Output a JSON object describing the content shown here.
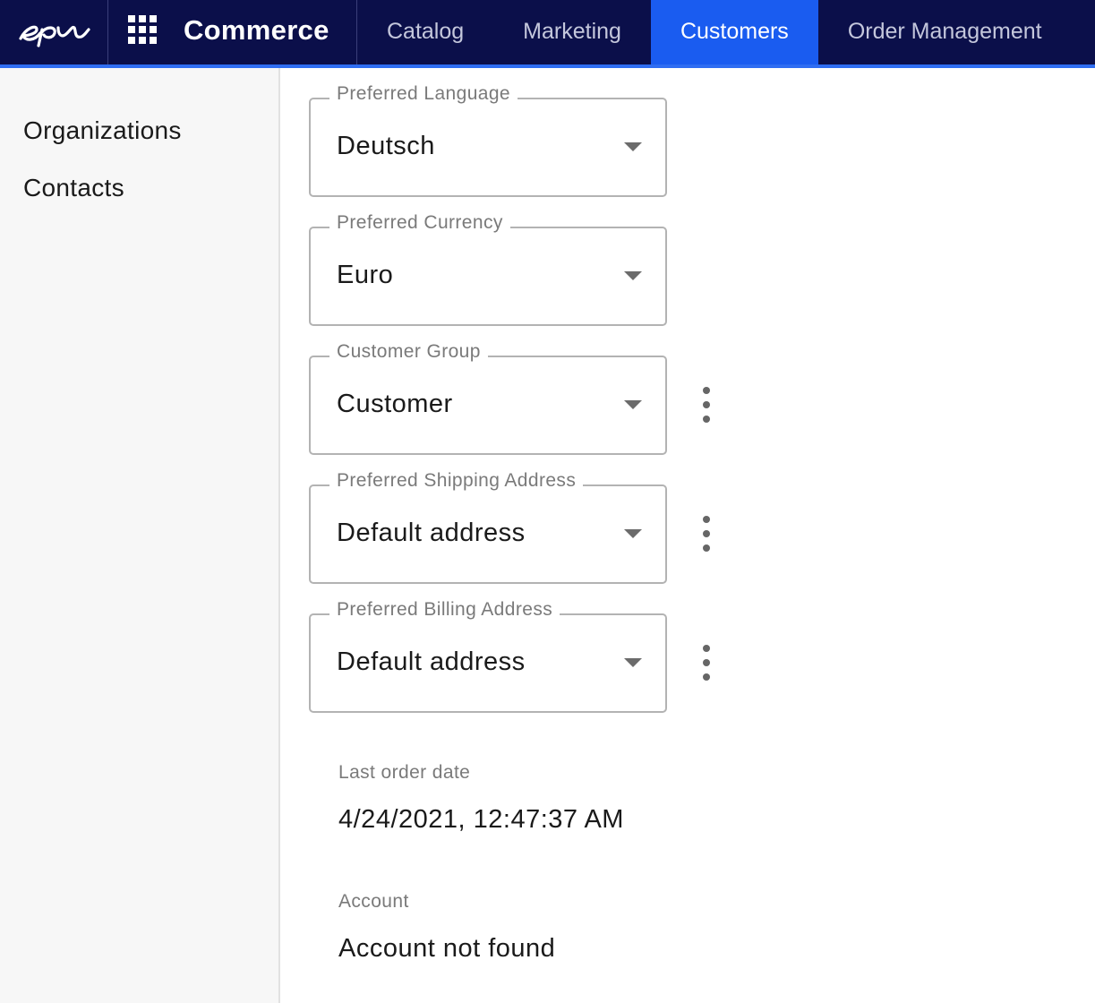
{
  "header": {
    "logo_text": "epi",
    "app_title": "Commerce",
    "nav": [
      {
        "label": "Catalog",
        "active": false
      },
      {
        "label": "Marketing",
        "active": false
      },
      {
        "label": "Customers",
        "active": true
      },
      {
        "label": "Order Management",
        "active": false
      }
    ]
  },
  "sidebar": {
    "items": [
      {
        "label": "Organizations"
      },
      {
        "label": "Contacts"
      }
    ]
  },
  "form": {
    "preferred_language": {
      "label": "Preferred Language",
      "value": "Deutsch"
    },
    "preferred_currency": {
      "label": "Preferred Currency",
      "value": "Euro"
    },
    "customer_group": {
      "label": "Customer Group",
      "value": "Customer"
    },
    "preferred_shipping_address": {
      "label": "Preferred Shipping Address",
      "value": "Default address"
    },
    "preferred_billing_address": {
      "label": "Preferred Billing Address",
      "value": "Default address"
    },
    "last_order_date": {
      "label": "Last order date",
      "value": "4/24/2021, 12:47:37 AM"
    },
    "account": {
      "label": "Account",
      "value": "Account not found"
    }
  },
  "colors": {
    "header_bg": "#0b0f4a",
    "active_tab": "#1a5cf0",
    "accent_line": "#2f6df2"
  }
}
